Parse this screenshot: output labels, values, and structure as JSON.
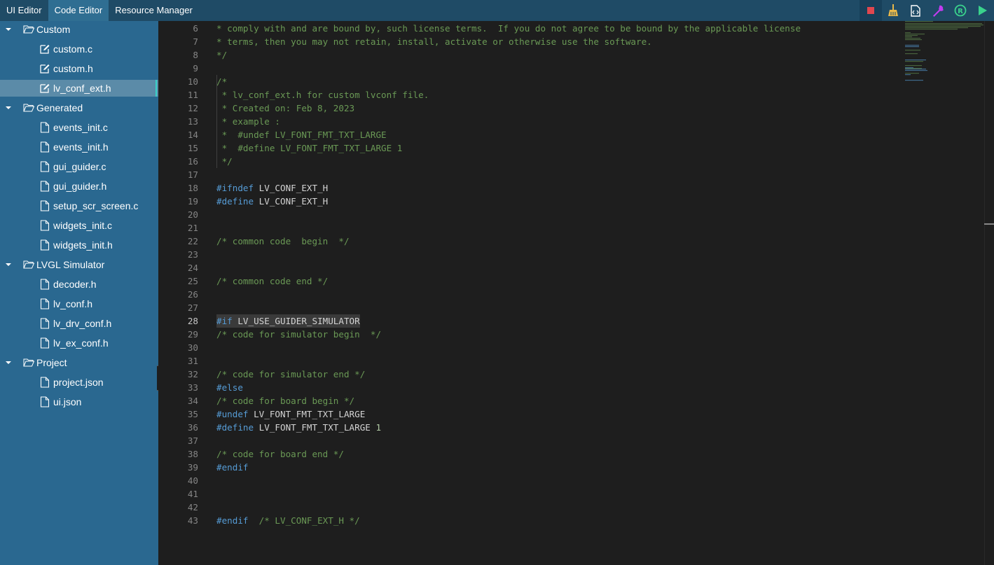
{
  "tabs": [
    {
      "label": "UI Editor",
      "active": false
    },
    {
      "label": "Code Editor",
      "active": true
    },
    {
      "label": "Resource Manager",
      "active": false
    }
  ],
  "toolbar": {
    "icons": [
      "stop-icon",
      "broom-icon",
      "code-file-icon",
      "wrench-icon",
      "register-icon",
      "run-icon"
    ],
    "colors": {
      "stop": "#e0474f",
      "broom": "#e8b84a",
      "code": "#ffffff",
      "wrench": "#c23cf0",
      "register": "#3ad28c",
      "run": "#3ad28c"
    }
  },
  "tree": [
    {
      "type": "folder",
      "label": "Custom"
    },
    {
      "type": "file",
      "label": "custom.c",
      "icon": "edit-icon"
    },
    {
      "type": "file",
      "label": "custom.h",
      "icon": "edit-icon"
    },
    {
      "type": "file",
      "label": "lv_conf_ext.h",
      "icon": "edit-icon",
      "selected": true
    },
    {
      "type": "folder",
      "label": "Generated"
    },
    {
      "type": "file",
      "label": "events_init.c",
      "icon": "file-icon"
    },
    {
      "type": "file",
      "label": "events_init.h",
      "icon": "file-icon"
    },
    {
      "type": "file",
      "label": "gui_guider.c",
      "icon": "file-icon"
    },
    {
      "type": "file",
      "label": "gui_guider.h",
      "icon": "file-icon"
    },
    {
      "type": "file",
      "label": "setup_scr_screen.c",
      "icon": "file-icon"
    },
    {
      "type": "file",
      "label": "widgets_init.c",
      "icon": "file-icon"
    },
    {
      "type": "file",
      "label": "widgets_init.h",
      "icon": "file-icon"
    },
    {
      "type": "folder",
      "label": "LVGL Simulator"
    },
    {
      "type": "file",
      "label": "decoder.h",
      "icon": "file-icon"
    },
    {
      "type": "file",
      "label": "lv_conf.h",
      "icon": "file-icon"
    },
    {
      "type": "file",
      "label": "lv_drv_conf.h",
      "icon": "file-icon"
    },
    {
      "type": "file",
      "label": "lv_ex_conf.h",
      "icon": "file-icon"
    },
    {
      "type": "folder",
      "label": "Project"
    },
    {
      "type": "file",
      "label": "project.json",
      "icon": "file-icon"
    },
    {
      "type": "file",
      "label": "ui.json",
      "icon": "file-icon"
    }
  ],
  "editor": {
    "current_line": 28,
    "lines": [
      {
        "n": "6",
        "parts": [
          [
            "cm",
            "* comply with and are bound by, such license terms.  If you do not agree to be bound by the applicable license"
          ]
        ]
      },
      {
        "n": "7",
        "parts": [
          [
            "cm",
            "* terms, then you may not retain, install, activate or otherwise use the software."
          ]
        ]
      },
      {
        "n": "8",
        "parts": [
          [
            "cm",
            "*/"
          ]
        ]
      },
      {
        "n": "9",
        "parts": []
      },
      {
        "n": "10",
        "parts": [
          [
            "cm",
            "/*"
          ]
        ]
      },
      {
        "n": "11",
        "parts": [
          [
            "cm",
            " * lv_conf_ext.h for custom lvconf file."
          ]
        ]
      },
      {
        "n": "12",
        "parts": [
          [
            "cm",
            " * Created on: Feb 8, 2023"
          ]
        ]
      },
      {
        "n": "13",
        "parts": [
          [
            "cm",
            " * example :"
          ]
        ]
      },
      {
        "n": "14",
        "parts": [
          [
            "cm",
            " *  #undef LV_FONT_FMT_TXT_LARGE"
          ]
        ]
      },
      {
        "n": "15",
        "parts": [
          [
            "cm",
            " *  #define LV_FONT_FMT_TXT_LARGE 1"
          ]
        ]
      },
      {
        "n": "16",
        "parts": [
          [
            "cm",
            " */"
          ]
        ]
      },
      {
        "n": "17",
        "parts": []
      },
      {
        "n": "18",
        "parts": [
          [
            "kw",
            "#ifndef"
          ],
          [
            "id",
            " LV_CONF_EXT_H"
          ]
        ]
      },
      {
        "n": "19",
        "parts": [
          [
            "kw",
            "#define"
          ],
          [
            "id",
            " LV_CONF_EXT_H"
          ]
        ]
      },
      {
        "n": "20",
        "parts": []
      },
      {
        "n": "21",
        "parts": []
      },
      {
        "n": "22",
        "parts": [
          [
            "cm",
            "/* common code  begin  */"
          ]
        ]
      },
      {
        "n": "23",
        "parts": []
      },
      {
        "n": "24",
        "parts": []
      },
      {
        "n": "25",
        "parts": [
          [
            "cm",
            "/* common code end */"
          ]
        ]
      },
      {
        "n": "26",
        "parts": []
      },
      {
        "n": "27",
        "parts": []
      },
      {
        "n": "28",
        "parts": [
          [
            "kw",
            "#if"
          ],
          [
            "id",
            " LV_USE_GUIDER_SIMULATOR"
          ]
        ]
      },
      {
        "n": "29",
        "parts": [
          [
            "cm",
            "/* code for simulator begin  */"
          ]
        ]
      },
      {
        "n": "30",
        "parts": []
      },
      {
        "n": "31",
        "parts": []
      },
      {
        "n": "32",
        "parts": [
          [
            "cm",
            "/* code for simulator end */"
          ]
        ]
      },
      {
        "n": "33",
        "parts": [
          [
            "kw",
            "#else"
          ]
        ]
      },
      {
        "n": "34",
        "parts": [
          [
            "cm",
            "/* code for board begin */"
          ]
        ]
      },
      {
        "n": "35",
        "parts": [
          [
            "kw",
            "#undef"
          ],
          [
            "id",
            " LV_FONT_FMT_TXT_LARGE"
          ]
        ]
      },
      {
        "n": "36",
        "parts": [
          [
            "kw",
            "#define"
          ],
          [
            "id",
            " LV_FONT_FMT_TXT_LARGE "
          ],
          [
            "num",
            "1"
          ]
        ]
      },
      {
        "n": "37",
        "parts": []
      },
      {
        "n": "38",
        "parts": [
          [
            "cm",
            "/* code for board end */"
          ]
        ]
      },
      {
        "n": "39",
        "parts": [
          [
            "kw",
            "#endif"
          ]
        ]
      },
      {
        "n": "40",
        "parts": []
      },
      {
        "n": "41",
        "parts": []
      },
      {
        "n": "42",
        "parts": []
      },
      {
        "n": "43",
        "parts": [
          [
            "kw",
            "#endif"
          ],
          [
            "cm",
            "  /* LV_CONF_EXT_H */"
          ]
        ]
      }
    ]
  }
}
